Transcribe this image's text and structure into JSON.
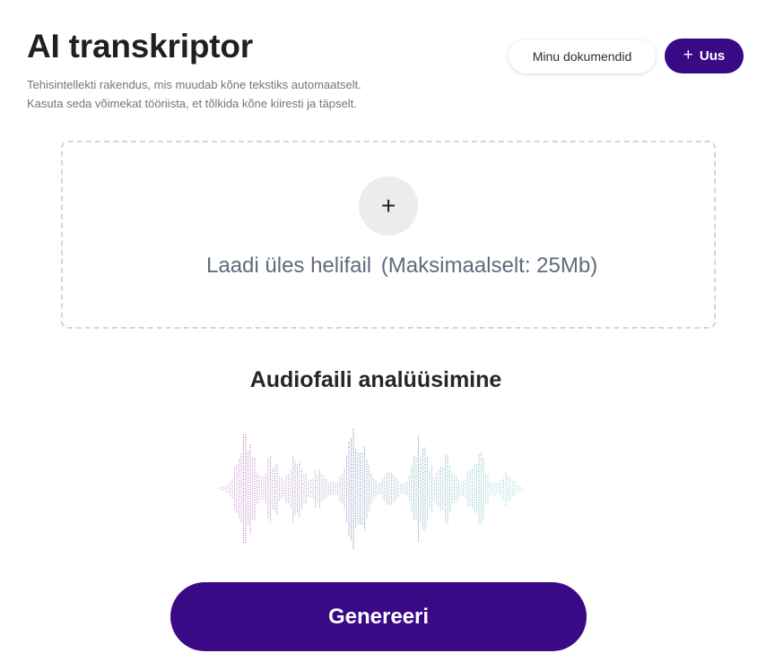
{
  "header": {
    "title": "AI transkriptor",
    "subtitle_line1": "Tehisintellekti rakendus, mis muudab kõne tekstiks automaatselt.",
    "subtitle_line2": "Kasuta seda võimekat tööriista, et tõlkida kõne kiiresti ja täpselt."
  },
  "actions": {
    "my_documents_label": "Minu dokumendid",
    "new_label": "Uus",
    "new_icon": "plus-icon"
  },
  "upload": {
    "icon": "plus-icon",
    "label": "Laadi üles helifail",
    "limit": "(Maksimaalselt: 25Mb)"
  },
  "analysis": {
    "title": "Audiofaili analüüsimine",
    "waveform_colors": [
      "#b04aa8",
      "#4e6f9e",
      "#3fb8b8"
    ]
  },
  "generate": {
    "label": "Genereeri"
  },
  "theme": {
    "primary": "#3a0a86",
    "muted_text": "#5f6b7c"
  }
}
